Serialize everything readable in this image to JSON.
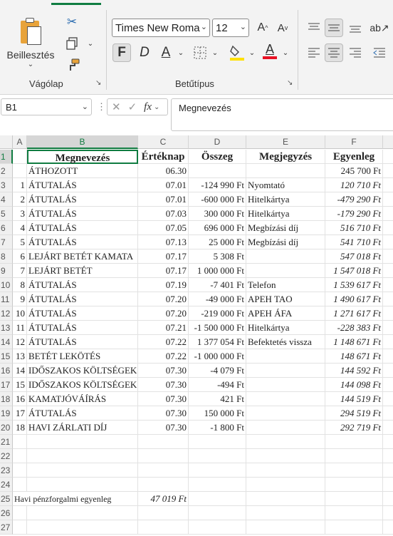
{
  "ribbon": {
    "clipboard": {
      "paste_label": "Beillesztés",
      "group_label": "Vágólap"
    },
    "font": {
      "family": "Times New Roma",
      "size": "12",
      "group_label": "Betűtípus",
      "bold": "F",
      "italic": "D",
      "underline": "A",
      "font_color": "A"
    }
  },
  "formula_bar": {
    "name_box": "B1",
    "fx": "fx",
    "content": "Megnevezés"
  },
  "columns": [
    "A",
    "B",
    "C",
    "D",
    "E",
    "F"
  ],
  "headers": {
    "b": "Megnevezés",
    "c": "Értéknap",
    "d": "Összeg",
    "e": "Megjegyzés",
    "f": "Egyenleg"
  },
  "rows": [
    {
      "n": "1"
    },
    {
      "n": "2",
      "a": "",
      "b": "ÁTHOZOTT",
      "c": "06.30",
      "d": "",
      "e": "",
      "f": "245 700 Ft"
    },
    {
      "n": "3",
      "a": "1",
      "b": "ÁTUTALÁS",
      "c": "07.01",
      "d": "-124 990 Ft",
      "e": "Nyomtató",
      "f": "120 710 Ft"
    },
    {
      "n": "4",
      "a": "2",
      "b": "ÁTUTALÁS",
      "c": "07.01",
      "d": "-600 000 Ft",
      "e": "Hitelkártya",
      "f": "-479 290 Ft"
    },
    {
      "n": "5",
      "a": "3",
      "b": "ÁTUTALÁS",
      "c": "07.03",
      "d": "300 000 Ft",
      "e": "Hitelkártya",
      "f": "-179 290 Ft"
    },
    {
      "n": "6",
      "a": "4",
      "b": "ÁTUTALÁS",
      "c": "07.05",
      "d": "696 000 Ft",
      "e": "Megbízási díj",
      "f": "516 710 Ft"
    },
    {
      "n": "7",
      "a": "5",
      "b": "ÁTUTALÁS",
      "c": "07.13",
      "d": "25 000 Ft",
      "e": "Megbízási díj",
      "f": "541 710 Ft"
    },
    {
      "n": "8",
      "a": "6",
      "b": "LEJÁRT BETÉT KAMATA",
      "c": "07.17",
      "d": "5 308 Ft",
      "e": "",
      "f": "547 018 Ft"
    },
    {
      "n": "9",
      "a": "7",
      "b": "LEJÁRT BETÉT",
      "c": "07.17",
      "d": "1 000 000 Ft",
      "e": "",
      "f": "1 547 018 Ft"
    },
    {
      "n": "10",
      "a": "8",
      "b": "ÁTUTALÁS",
      "c": "07.19",
      "d": "-7 401 Ft",
      "e": "Telefon",
      "f": "1 539 617 Ft"
    },
    {
      "n": "11",
      "a": "9",
      "b": "ÁTUTALÁS",
      "c": "07.20",
      "d": "-49 000 Ft",
      "e": "APEH TAO",
      "f": "1 490 617 Ft"
    },
    {
      "n": "12",
      "a": "10",
      "b": "ÁTUTALÁS",
      "c": "07.20",
      "d": "-219 000 Ft",
      "e": "APEH ÁFA",
      "f": "1 271 617 Ft"
    },
    {
      "n": "13",
      "a": "11",
      "b": "ÁTUTALÁS",
      "c": "07.21",
      "d": "-1 500 000 Ft",
      "e": "Hitelkártya",
      "f": "-228 383 Ft"
    },
    {
      "n": "14",
      "a": "12",
      "b": "ÁTUTALÁS",
      "c": "07.22",
      "d": "1 377 054 Ft",
      "e": "Befektetés vissza",
      "f": "1 148 671 Ft"
    },
    {
      "n": "15",
      "a": "13",
      "b": "BETÉT LEKÖTÉS",
      "c": "07.22",
      "d": "-1 000 000 Ft",
      "e": "",
      "f": "148 671 Ft"
    },
    {
      "n": "16",
      "a": "14",
      "b": "IDŐSZAKOS KÖLTSÉGEK",
      "c": "07.30",
      "d": "-4 079 Ft",
      "e": "",
      "f": "144 592 Ft"
    },
    {
      "n": "17",
      "a": "15",
      "b": "IDŐSZAKOS KÖLTSÉGEK",
      "c": "07.30",
      "d": "-494 Ft",
      "e": "",
      "f": "144 098 Ft"
    },
    {
      "n": "18",
      "a": "16",
      "b": "KAMATJÓVÁÍRÁS",
      "c": "07.30",
      "d": "421 Ft",
      "e": "",
      "f": "144 519 Ft"
    },
    {
      "n": "19",
      "a": "17",
      "b": "ÁTUTALÁS",
      "c": "07.30",
      "d": "150 000 Ft",
      "e": "",
      "f": "294 519 Ft"
    },
    {
      "n": "20",
      "a": "18",
      "b": "HAVI ZÁRLATI DÍJ",
      "c": "07.30",
      "d": "-1 800 Ft",
      "e": "",
      "f": "292 719 Ft"
    },
    {
      "n": "21"
    },
    {
      "n": "22"
    },
    {
      "n": "23"
    },
    {
      "n": "24"
    },
    {
      "n": "25",
      "summary_label": "Havi pénzforgalmi egyenleg",
      "summary_value": "47 019 Ft"
    },
    {
      "n": "26"
    },
    {
      "n": "27"
    }
  ],
  "colors": {
    "accent": "#107c41",
    "highlight": "#ffe100",
    "font_red": "#e81123"
  }
}
